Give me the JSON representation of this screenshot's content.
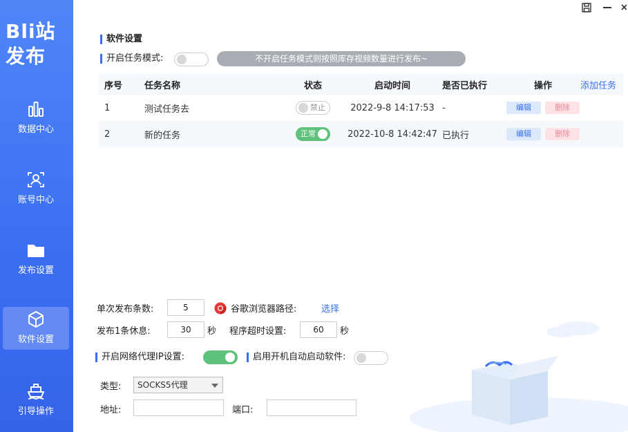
{
  "app": {
    "brand_line1": "Bli站",
    "brand_line2": "发布"
  },
  "sidebar": {
    "items": [
      {
        "label": "数据中心",
        "icon": "bar-chart-icon"
      },
      {
        "label": "账号中心",
        "icon": "user-scan-icon"
      },
      {
        "label": "发布设置",
        "icon": "folder-icon"
      },
      {
        "label": "软件设置",
        "icon": "cube-icon",
        "active": true
      },
      {
        "label": "引导操作",
        "icon": "ship-icon"
      }
    ]
  },
  "settings": {
    "section_title": "软件设置",
    "task_mode_label": "开启任务模式:",
    "task_mode_on": false,
    "task_mode_hint": "不开启任务模式则按照库存视频数量进行发布~"
  },
  "tasks": {
    "headers": {
      "no": "序号",
      "name": "任务名称",
      "status": "状态",
      "time": "启动时间",
      "executed": "是否已执行",
      "ops": "操作"
    },
    "add_label": "添加任务",
    "edit_label": "编辑",
    "delete_label": "删除",
    "rows": [
      {
        "no": "1",
        "name": "测试任务去",
        "status": "禁止",
        "enabled": false,
        "time": "2022-9-8 14:17:53",
        "executed": "-"
      },
      {
        "no": "2",
        "name": "新的任务",
        "status": "正常",
        "enabled": true,
        "time": "2022-10-8 14:42:47",
        "executed": "已执行"
      }
    ]
  },
  "form": {
    "per_publish_label": "单次发布条数:",
    "per_publish_value": "5",
    "chrome_path_label": "谷歌浏览器路径:",
    "chrome_select_link": "选择",
    "rest_label": "发布1条休息:",
    "rest_value": "30",
    "rest_unit": "秒",
    "timeout_label": "程序超时设置:",
    "timeout_value": "60",
    "timeout_unit": "秒",
    "proxy_label": "开启网络代理IP设置:",
    "proxy_on": true,
    "autostart_label": "启用开机自动启动软件:",
    "autostart_on": false,
    "type_label": "类型:",
    "type_value": "SOCKS5代理",
    "address_label": "地址:",
    "address_value": "",
    "port_label": "端口:",
    "port_value": ""
  },
  "colors": {
    "accent": "#3a6ef2",
    "toggle_on": "#5fc27a",
    "sidebar_top": "#4f86f7"
  }
}
